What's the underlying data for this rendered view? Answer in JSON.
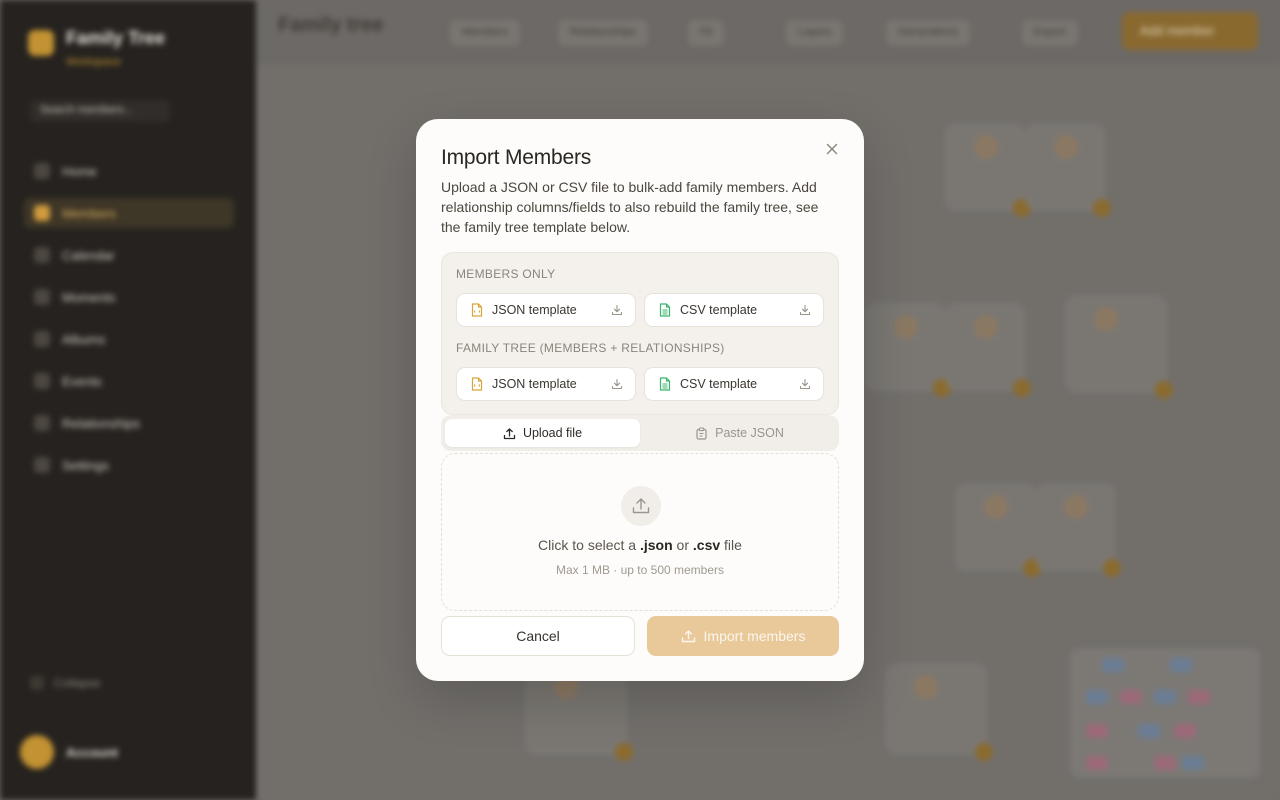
{
  "background": {
    "sidebar": {
      "brand": "Family Tree",
      "subtitle": "Workspace",
      "search_placeholder": "Search members...",
      "items": [
        "Home",
        "Members",
        "Calendar",
        "Moments",
        "Albums",
        "Events",
        "Relationships",
        "Settings"
      ],
      "active_index": 1,
      "footer_item": "Collapse",
      "user_name": "Account"
    },
    "topbar": {
      "title": "Family tree",
      "pills": [
        "Members",
        "Relationships",
        "Fit",
        "Layers",
        "Generations",
        "Export"
      ],
      "primary_button": "Add member"
    }
  },
  "modal": {
    "title": "Import Members",
    "description": "Upload a JSON or CSV file to bulk-add family members. Add relationship columns/fields to also rebuild the family tree, see the family tree template below.",
    "members_only_heading": "Members only",
    "family_tree_heading": "Family tree (members + relationships)",
    "members_only": {
      "json_label": "JSON template",
      "csv_label": "CSV template"
    },
    "family_tree": {
      "json_label": "JSON template",
      "csv_label": "CSV template"
    },
    "tabs": {
      "upload": "Upload file",
      "paste": "Paste JSON"
    },
    "dropzone": {
      "prefix": "Click to select a",
      "ext_json": ".json",
      "or": "or",
      "ext_csv": ".csv",
      "suffix": "file",
      "limits": "Max 1 MB · up to 500 members"
    },
    "cancel_label": "Cancel",
    "import_label": "Import members"
  },
  "colors": {
    "accent": "#e9c89a",
    "json_icon": "#d9a33b",
    "csv_icon": "#3bb56b"
  }
}
